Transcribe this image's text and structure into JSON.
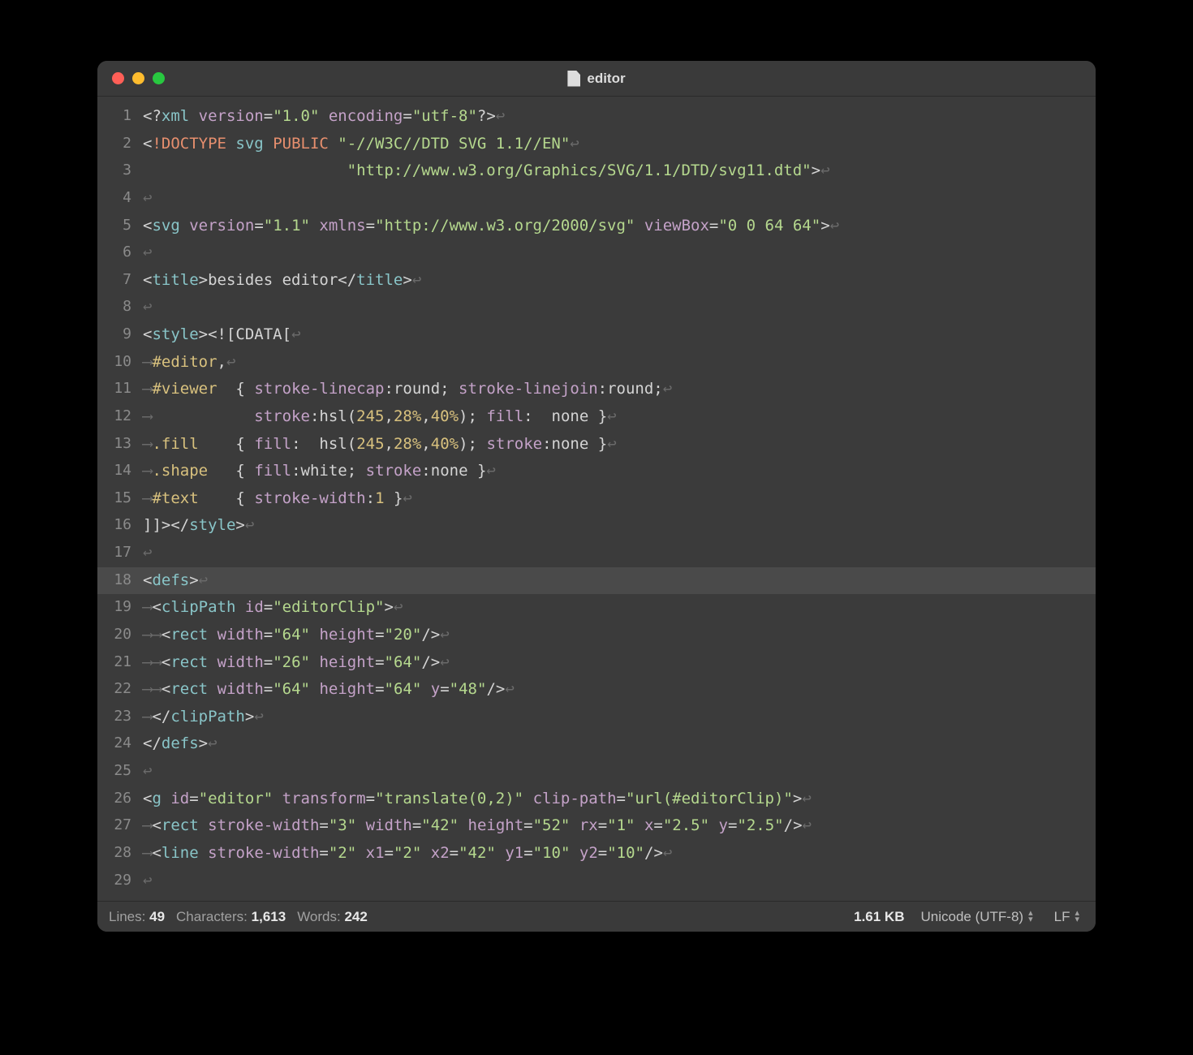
{
  "window": {
    "title": "editor"
  },
  "code_lines": [
    {
      "n": 1,
      "html": "<span class='tok-br'>&lt;?</span><span class='tok-tag'>xml</span> <span class='tok-attr'>version</span><span class='tok-punct'>=</span><span class='tok-str'>\"1.0\"</span> <span class='tok-attr'>encoding</span><span class='tok-punct'>=</span><span class='tok-str'>\"utf-8\"</span><span class='tok-br'>?&gt;</span><span class='nl-mark'>↩</span>"
    },
    {
      "n": 2,
      "html": "<span class='tok-br'>&lt;</span><span class='tok-kwd'>!DOCTYPE</span> <span class='tok-tag'>svg</span> <span class='tok-kwd'>PUBLIC</span> <span class='tok-str'>\"-//W3C//DTD SVG 1.1//EN\"</span><span class='nl-mark'>↩</span>"
    },
    {
      "n": 3,
      "html": "                      <span class='tok-str'>\"http://www.w3.org/Graphics/SVG/1.1/DTD/svg11.dtd\"</span><span class='tok-br'>&gt;</span><span class='nl-mark'>↩</span>"
    },
    {
      "n": 4,
      "html": "<span class='nl-mark'>↩</span>"
    },
    {
      "n": 5,
      "html": "<span class='tok-br'>&lt;</span><span class='tok-tag'>svg</span> <span class='tok-attr'>version</span><span class='tok-punct'>=</span><span class='tok-str'>\"1.1\"</span> <span class='tok-attr'>xmlns</span><span class='tok-punct'>=</span><span class='tok-str'>\"http://www.w3.org/2000/svg\"</span> <span class='tok-attr'>viewBox</span><span class='tok-punct'>=</span><span class='tok-str'>\"0 0 64 64\"</span><span class='tok-br'>&gt;</span><span class='nl-mark'>↩</span>"
    },
    {
      "n": 6,
      "html": "<span class='nl-mark'>↩</span>"
    },
    {
      "n": 7,
      "html": "<span class='tok-br'>&lt;</span><span class='tok-tag'>title</span><span class='tok-br'>&gt;</span>besides editor<span class='tok-br'>&lt;/</span><span class='tok-tag'>title</span><span class='tok-br'>&gt;</span><span class='nl-mark'>↩</span>"
    },
    {
      "n": 8,
      "html": "<span class='nl-mark'>↩</span>"
    },
    {
      "n": 9,
      "html": "<span class='tok-br'>&lt;</span><span class='tok-tag'>style</span><span class='tok-br'>&gt;</span><span class='tok-punct'>&lt;![CDATA[</span><span class='nl-mark'>↩</span>"
    },
    {
      "n": 10,
      "html": "<span class='tab-mark'>⟶</span><span class='tok-sel'>#editor</span><span class='tok-punct'>,</span><span class='nl-mark'>↩</span>"
    },
    {
      "n": 11,
      "html": "<span class='tab-mark'>⟶</span><span class='tok-sel'>#viewer</span>  <span class='tok-punct'>{</span> <span class='tok-prop'>stroke-linecap</span><span class='tok-punct'>:</span>round<span class='tok-punct'>;</span> <span class='tok-prop'>stroke-linejoin</span><span class='tok-punct'>:</span>round<span class='tok-punct'>;</span><span class='nl-mark'>↩</span>"
    },
    {
      "n": 12,
      "html": "<span class='tab-mark'>⟶</span>           <span class='tok-prop'>stroke</span><span class='tok-punct'>:</span>hsl(<span class='tok-num'>245</span>,<span class='tok-num'>28%</span>,<span class='tok-num'>40%</span>)<span class='tok-punct'>;</span> <span class='tok-prop'>fill</span><span class='tok-punct'>:</span>  none <span class='tok-punct'>}</span><span class='nl-mark'>↩</span>"
    },
    {
      "n": 13,
      "html": "<span class='tab-mark'>⟶</span><span class='tok-sel'>.fill</span>    <span class='tok-punct'>{</span> <span class='tok-prop'>fill</span><span class='tok-punct'>:</span>  hsl(<span class='tok-num'>245</span>,<span class='tok-num'>28%</span>,<span class='tok-num'>40%</span>)<span class='tok-punct'>;</span> <span class='tok-prop'>stroke</span><span class='tok-punct'>:</span>none <span class='tok-punct'>}</span><span class='nl-mark'>↩</span>"
    },
    {
      "n": 14,
      "html": "<span class='tab-mark'>⟶</span><span class='tok-sel'>.shape</span>   <span class='tok-punct'>{</span> <span class='tok-prop'>fill</span><span class='tok-punct'>:</span>white<span class='tok-punct'>;</span> <span class='tok-prop'>stroke</span><span class='tok-punct'>:</span>none <span class='tok-punct'>}</span><span class='nl-mark'>↩</span>"
    },
    {
      "n": 15,
      "html": "<span class='tab-mark'>⟶</span><span class='tok-sel'>#text</span>    <span class='tok-punct'>{</span> <span class='tok-prop'>stroke-width</span><span class='tok-punct'>:</span><span class='tok-num'>1</span> <span class='tok-punct'>}</span><span class='nl-mark'>↩</span>"
    },
    {
      "n": 16,
      "html": "<span class='tok-punct'>]]&gt;</span><span class='tok-br'>&lt;/</span><span class='tok-tag'>style</span><span class='tok-br'>&gt;</span><span class='nl-mark'>↩</span>"
    },
    {
      "n": 17,
      "html": "<span class='nl-mark'>↩</span>"
    },
    {
      "n": 18,
      "html": "<span class='tok-br'>&lt;</span><span class='tok-tag'>defs</span><span class='tok-br'>&gt;</span><span class='nl-mark'>↩</span>",
      "current": true
    },
    {
      "n": 19,
      "html": "<span class='tab-mark'>⟶</span><span class='tok-br'>&lt;</span><span class='tok-tag'>clipPath</span> <span class='tok-attr'>id</span><span class='tok-punct'>=</span><span class='tok-str'>\"editorClip\"</span><span class='tok-br'>&gt;</span><span class='nl-mark'>↩</span>"
    },
    {
      "n": 20,
      "html": "<span class='tab-mark'>⟶</span><span class='tab-mark'>⟶</span><span class='tok-br'>&lt;</span><span class='tok-tag'>rect</span> <span class='tok-attr'>width</span><span class='tok-punct'>=</span><span class='tok-str'>\"64\"</span> <span class='tok-attr'>height</span><span class='tok-punct'>=</span><span class='tok-str'>\"20\"</span><span class='tok-br'>/&gt;</span><span class='nl-mark'>↩</span>"
    },
    {
      "n": 21,
      "html": "<span class='tab-mark'>⟶</span><span class='tab-mark'>⟶</span><span class='tok-br'>&lt;</span><span class='tok-tag'>rect</span> <span class='tok-attr'>width</span><span class='tok-punct'>=</span><span class='tok-str'>\"26\"</span> <span class='tok-attr'>height</span><span class='tok-punct'>=</span><span class='tok-str'>\"64\"</span><span class='tok-br'>/&gt;</span><span class='nl-mark'>↩</span>"
    },
    {
      "n": 22,
      "html": "<span class='tab-mark'>⟶</span><span class='tab-mark'>⟶</span><span class='tok-br'>&lt;</span><span class='tok-tag'>rect</span> <span class='tok-attr'>width</span><span class='tok-punct'>=</span><span class='tok-str'>\"64\"</span> <span class='tok-attr'>height</span><span class='tok-punct'>=</span><span class='tok-str'>\"64\"</span> <span class='tok-attr'>y</span><span class='tok-punct'>=</span><span class='tok-str'>\"48\"</span><span class='tok-br'>/&gt;</span><span class='nl-mark'>↩</span>"
    },
    {
      "n": 23,
      "html": "<span class='tab-mark'>⟶</span><span class='tok-br'>&lt;/</span><span class='tok-tag'>clipPath</span><span class='tok-br'>&gt;</span><span class='nl-mark'>↩</span>"
    },
    {
      "n": 24,
      "html": "<span class='tok-br'>&lt;/</span><span class='tok-tag'>defs</span><span class='tok-br'>&gt;</span><span class='nl-mark'>↩</span>"
    },
    {
      "n": 25,
      "html": "<span class='nl-mark'>↩</span>"
    },
    {
      "n": 26,
      "html": "<span class='tok-br'>&lt;</span><span class='tok-tag'>g</span> <span class='tok-attr'>id</span><span class='tok-punct'>=</span><span class='tok-str'>\"editor\"</span> <span class='tok-attr'>transform</span><span class='tok-punct'>=</span><span class='tok-str'>\"translate(0,2)\"</span> <span class='tok-attr'>clip-path</span><span class='tok-punct'>=</span><span class='tok-str'>\"url(#editorClip)\"</span><span class='tok-br'>&gt;</span><span class='nl-mark'>↩</span>"
    },
    {
      "n": 27,
      "html": "<span class='tab-mark'>⟶</span><span class='tok-br'>&lt;</span><span class='tok-tag'>rect</span> <span class='tok-attr'>stroke-width</span><span class='tok-punct'>=</span><span class='tok-str'>\"3\"</span> <span class='tok-attr'>width</span><span class='tok-punct'>=</span><span class='tok-str'>\"42\"</span> <span class='tok-attr'>height</span><span class='tok-punct'>=</span><span class='tok-str'>\"52\"</span> <span class='tok-attr'>rx</span><span class='tok-punct'>=</span><span class='tok-str'>\"1\"</span> <span class='tok-attr'>x</span><span class='tok-punct'>=</span><span class='tok-str'>\"2.5\"</span> <span class='tok-attr'>y</span><span class='tok-punct'>=</span><span class='tok-str'>\"2.5\"</span><span class='tok-br'>/&gt;</span><span class='nl-mark'>↩</span>"
    },
    {
      "n": 28,
      "html": "<span class='tab-mark'>⟶</span><span class='tok-br'>&lt;</span><span class='tok-tag'>line</span> <span class='tok-attr'>stroke-width</span><span class='tok-punct'>=</span><span class='tok-str'>\"2\"</span> <span class='tok-attr'>x1</span><span class='tok-punct'>=</span><span class='tok-str'>\"2\"</span> <span class='tok-attr'>x2</span><span class='tok-punct'>=</span><span class='tok-str'>\"42\"</span> <span class='tok-attr'>y1</span><span class='tok-punct'>=</span><span class='tok-str'>\"10\"</span> <span class='tok-attr'>y2</span><span class='tok-punct'>=</span><span class='tok-str'>\"10\"</span><span class='tok-br'>/&gt;</span><span class='nl-mark'>↩</span>"
    },
    {
      "n": 29,
      "html": "<span class='nl-mark'>↩</span>"
    }
  ],
  "status": {
    "lines_label": "Lines:",
    "lines_value": "49",
    "chars_label": "Characters:",
    "chars_value": "1,613",
    "words_label": "Words:",
    "words_value": "242",
    "size": "1.61 KB",
    "encoding": "Unicode (UTF-8)",
    "line_ending": "LF"
  }
}
